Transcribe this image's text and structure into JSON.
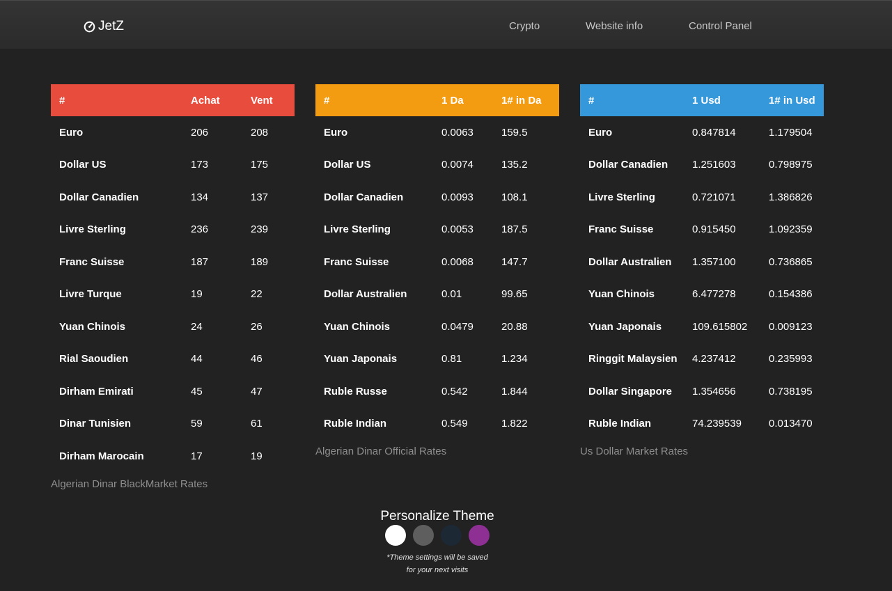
{
  "header": {
    "brand": "JetZ",
    "nav": [
      "Crypto",
      "Website info",
      "Control Panel"
    ]
  },
  "tables": [
    {
      "headers": [
        "#",
        "Achat",
        "Vent"
      ],
      "accent": "#e74c3c",
      "rows": [
        [
          "Euro",
          "206",
          "208"
        ],
        [
          "Dollar US",
          "173",
          "175"
        ],
        [
          "Dollar Canadien",
          "134",
          "137"
        ],
        [
          "Livre Sterling",
          "236",
          "239"
        ],
        [
          "Franc Suisse",
          "187",
          "189"
        ],
        [
          "Livre Turque",
          "19",
          "22"
        ],
        [
          "Yuan Chinois",
          "24",
          "26"
        ],
        [
          "Rial Saoudien",
          "44",
          "46"
        ],
        [
          "Dirham Emirati",
          "45",
          "47"
        ],
        [
          "Dinar Tunisien",
          "59",
          "61"
        ],
        [
          "Dirham Marocain",
          "17",
          "19"
        ]
      ],
      "caption": "Algerian Dinar BlackMarket Rates"
    },
    {
      "headers": [
        "#",
        "1 Da",
        "1# in Da"
      ],
      "accent": "#f39c12",
      "rows": [
        [
          "Euro",
          "0.0063",
          "159.5"
        ],
        [
          "Dollar US",
          "0.0074",
          "135.2"
        ],
        [
          "Dollar Canadien",
          "0.0093",
          "108.1"
        ],
        [
          "Livre Sterling",
          "0.0053",
          "187.5"
        ],
        [
          "Franc Suisse",
          "0.0068",
          "147.7"
        ],
        [
          "Dollar Australien",
          "0.01",
          "99.65"
        ],
        [
          "Yuan Chinois",
          "0.0479",
          "20.88"
        ],
        [
          "Yuan Japonais",
          "0.81",
          "1.234"
        ],
        [
          "Ruble Russe",
          "0.542",
          "1.844"
        ],
        [
          "Ruble Indian",
          "0.549",
          "1.822"
        ]
      ],
      "caption": "Algerian Dinar Official Rates"
    },
    {
      "headers": [
        "#",
        "1 Usd",
        "1# in Usd"
      ],
      "accent": "#3498db",
      "rows": [
        [
          "Euro",
          "0.847814",
          "1.179504"
        ],
        [
          "Dollar Canadien",
          "1.251603",
          "0.798975"
        ],
        [
          "Livre Sterling",
          "0.721071",
          "1.386826"
        ],
        [
          "Franc Suisse",
          "0.915450",
          "1.092359"
        ],
        [
          "Dollar Australien",
          "1.357100",
          "0.736865"
        ],
        [
          "Yuan Chinois",
          "6.477278",
          "0.154386"
        ],
        [
          "Yuan Japonais",
          "109.615802",
          "0.009123"
        ],
        [
          "Ringgit Malaysien",
          "4.237412",
          "0.235993"
        ],
        [
          "Dollar Singapore",
          "1.354656",
          "0.738195"
        ],
        [
          "Ruble Indian",
          "74.239539",
          "0.013470"
        ]
      ],
      "caption": "Us Dollar Market Rates"
    }
  ],
  "theme": {
    "title": "Personalize Theme",
    "swatches": [
      "#ffffff",
      "#5e5e5e",
      "#1c2833",
      "#8e2f94"
    ],
    "note_line1": "*Theme settings will be saved",
    "note_line2": "for your next visits"
  }
}
